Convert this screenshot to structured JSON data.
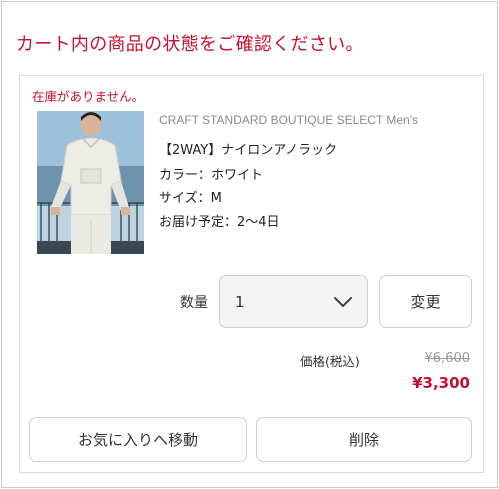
{
  "notice": "カート内の商品の状態をご確認ください。",
  "item": {
    "stock_status": "在庫がありません。",
    "brand": "CRAFT STANDARD BOUTIQUE SELECT Men's",
    "name": "【2WAY】ナイロンアノラック",
    "color": "カラー：ホワイト",
    "size": "サイズ：M",
    "delivery": "お届け予定：2〜4日",
    "quantity_label": "数量",
    "quantity_value": "1",
    "change_label": "変更",
    "price_label": "価格(税込)",
    "price_original": "¥6,600",
    "price_sale": "¥3,300"
  },
  "actions": {
    "favorite_label": "お気に入りへ移動",
    "delete_label": "削除"
  },
  "colors": {
    "accent_red": "#c8102e",
    "border": "#cfcfcf",
    "select_bg": "#f4f4f4"
  },
  "icons": {
    "quantity_dropdown": "chevron-down-icon"
  }
}
